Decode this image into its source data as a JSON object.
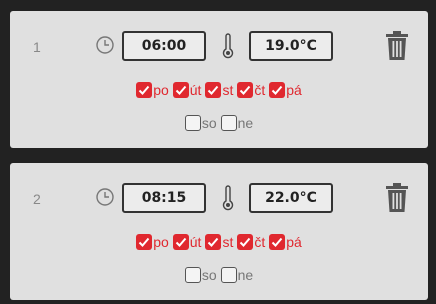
{
  "schedules": [
    {
      "index": "1",
      "time": "06:00",
      "temperature": "19.0°C",
      "weekdays": [
        {
          "label": "po",
          "checked": true
        },
        {
          "label": "út",
          "checked": true
        },
        {
          "label": "st",
          "checked": true
        },
        {
          "label": "čt",
          "checked": true
        },
        {
          "label": "pá",
          "checked": true
        }
      ],
      "weekend": [
        {
          "label": "so",
          "checked": false
        },
        {
          "label": "ne",
          "checked": false
        }
      ]
    },
    {
      "index": "2",
      "time": "08:15",
      "temperature": "22.0°C",
      "weekdays": [
        {
          "label": "po",
          "checked": true
        },
        {
          "label": "út",
          "checked": true
        },
        {
          "label": "st",
          "checked": true
        },
        {
          "label": "čt",
          "checked": true
        },
        {
          "label": "pá",
          "checked": true
        }
      ],
      "weekend": [
        {
          "label": "so",
          "checked": false
        },
        {
          "label": "ne",
          "checked": false
        }
      ]
    }
  ],
  "icons": {
    "clock": "clock-icon",
    "thermometer": "thermometer-icon",
    "delete": "trash-icon"
  },
  "colors": {
    "accent": "#e0282f",
    "card": "#e0e0e0",
    "background": "#222222"
  }
}
